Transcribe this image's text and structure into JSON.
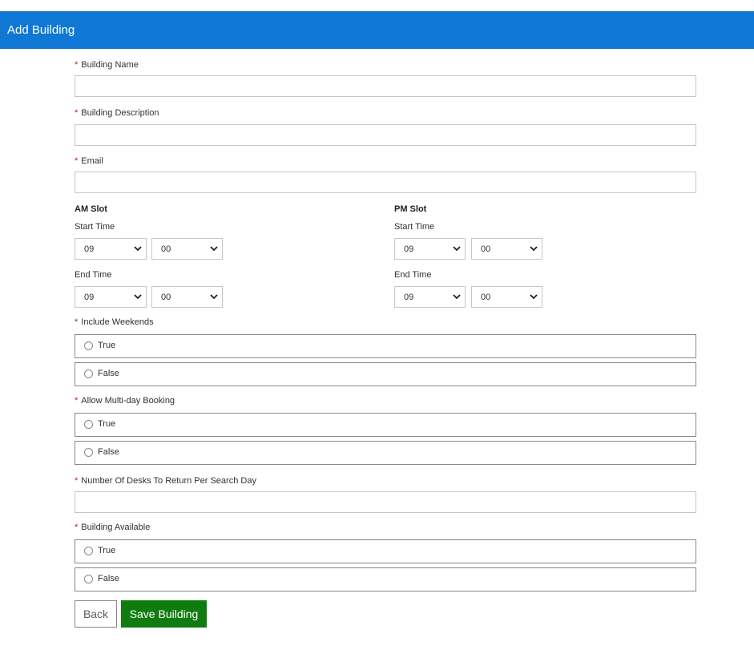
{
  "header": {
    "title": "Add Building"
  },
  "required_mark": "*",
  "fields": {
    "building_name": {
      "label": "Building Name",
      "value": ""
    },
    "building_description": {
      "label": "Building Description",
      "value": ""
    },
    "email": {
      "label": "Email",
      "value": ""
    },
    "desks_per_day": {
      "label": "Number Of Desks To Return Per Search Day",
      "value": ""
    }
  },
  "am_slot": {
    "title": "AM Slot",
    "start_label": "Start Time",
    "start_hour": "09",
    "start_minute": "00",
    "end_label": "End Time",
    "end_hour": "09",
    "end_minute": "00"
  },
  "pm_slot": {
    "title": "PM Slot",
    "start_label": "Start Time",
    "start_hour": "09",
    "start_minute": "00",
    "end_label": "End Time",
    "end_hour": "09",
    "end_minute": "00"
  },
  "radio_groups": {
    "include_weekends": {
      "label": "Include Weekends",
      "true_label": "True",
      "false_label": "False"
    },
    "multi_day": {
      "label": "Allow Multi-day Booking",
      "true_label": "True",
      "false_label": "False"
    },
    "building_available": {
      "label": "Building Available",
      "true_label": "True",
      "false_label": "False"
    }
  },
  "buttons": {
    "back": "Back",
    "save": "Save Building"
  },
  "colors": {
    "header_bg": "#0f78d4",
    "save_bg": "#107c10",
    "required": "#a4262c"
  },
  "icons": {
    "select_arrow": "chevron-down-icon",
    "radio": "radio-circle-icon"
  }
}
